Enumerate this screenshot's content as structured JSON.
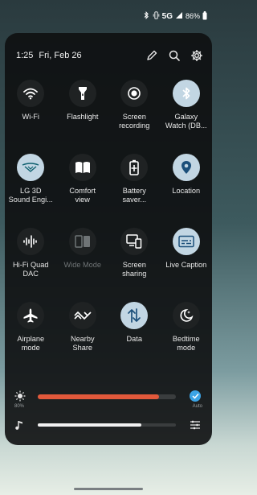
{
  "status": {
    "network": "5G",
    "battery": "86%"
  },
  "header": {
    "time": "1:25",
    "date": "Fri, Feb 26"
  },
  "tiles": [
    {
      "label": "Wi-Fi",
      "icon": "wifi-icon",
      "state": "off"
    },
    {
      "label": "Flashlight",
      "icon": "flashlight-icon",
      "state": "off"
    },
    {
      "label": "Screen\nrecording",
      "icon": "screen-recording-icon",
      "state": "off"
    },
    {
      "label": "Galaxy\nWatch (DB...",
      "icon": "bluetooth-icon",
      "state": "on"
    },
    {
      "label": "LG 3D\nSound Engi...",
      "icon": "sound-engine-icon",
      "state": "on"
    },
    {
      "label": "Comfort\nview",
      "icon": "book-icon",
      "state": "off"
    },
    {
      "label": "Battery\nsaver...",
      "icon": "battery-icon",
      "state": "off"
    },
    {
      "label": "Location",
      "icon": "location-pin-icon",
      "state": "on"
    },
    {
      "label": "Hi-Fi Quad\nDAC",
      "icon": "waveform-icon",
      "state": "off"
    },
    {
      "label": "Wide Mode",
      "icon": "wide-mode-icon",
      "state": "disabled"
    },
    {
      "label": "Screen\nsharing",
      "icon": "screen-share-icon",
      "state": "off"
    },
    {
      "label": "Live Caption",
      "icon": "caption-icon",
      "state": "on"
    },
    {
      "label": "Airplane\nmode",
      "icon": "airplane-icon",
      "state": "off"
    },
    {
      "label": "Nearby\nShare",
      "icon": "nearby-share-icon",
      "state": "off"
    },
    {
      "label": "Data",
      "icon": "data-arrows-icon",
      "state": "on"
    },
    {
      "label": "Bedtime\nmode",
      "icon": "moon-icon",
      "state": "off"
    }
  ],
  "brightness": {
    "percent_label": "80%",
    "level": 0.88,
    "auto_label": "Auto"
  },
  "media_volume": {
    "level": 0.75
  },
  "colors": {
    "accent": "#c2d6e3",
    "brightness_fill": "#e2593b",
    "auto_toggle": "#3ba4e6"
  }
}
